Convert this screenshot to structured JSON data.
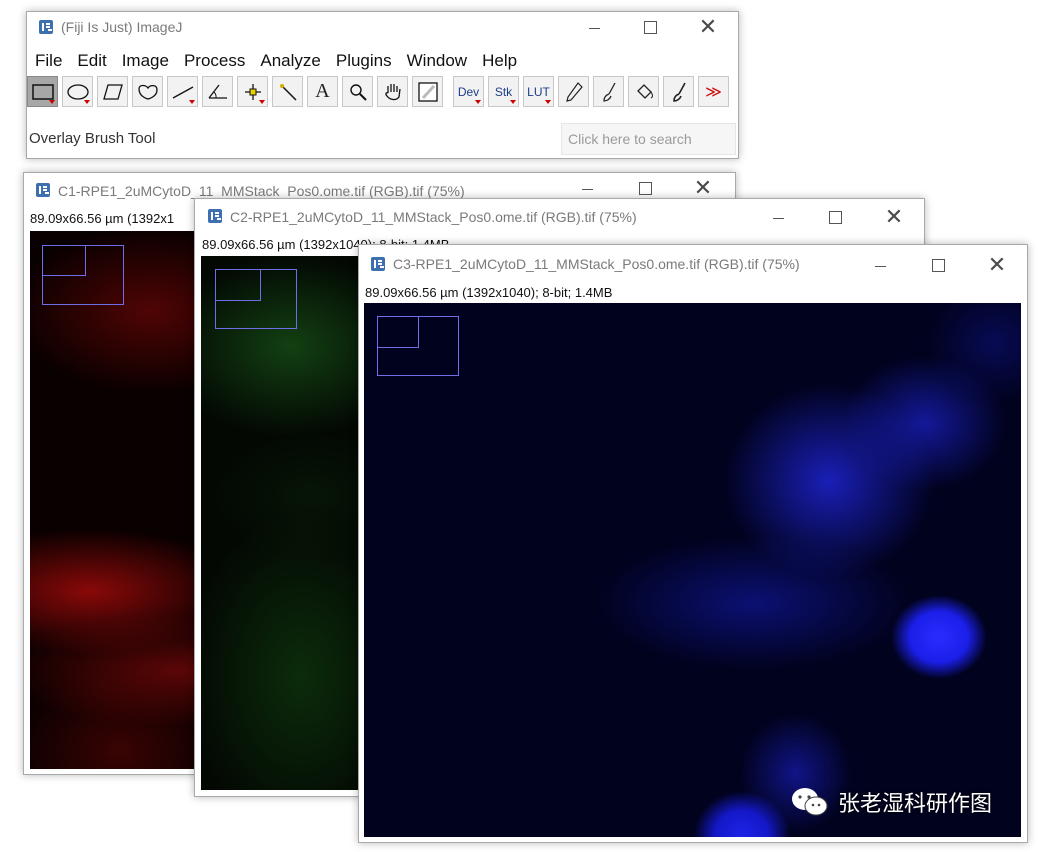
{
  "main_window": {
    "title": "(Fiji Is Just) ImageJ",
    "menu": [
      "File",
      "Edit",
      "Image",
      "Process",
      "Analyze",
      "Plugins",
      "Window",
      "Help"
    ],
    "tools": [
      {
        "name": "rectangle-tool",
        "glyph": "▭"
      },
      {
        "name": "oval-tool",
        "glyph": "◯"
      },
      {
        "name": "polygon-tool",
        "glyph": "⬠"
      },
      {
        "name": "freehand-tool",
        "glyph": "♡"
      },
      {
        "name": "line-tool",
        "glyph": "╱"
      },
      {
        "name": "angle-tool",
        "glyph": "∠"
      },
      {
        "name": "point-tool",
        "glyph": "✛"
      },
      {
        "name": "wand-tool",
        "glyph": "⟋"
      },
      {
        "name": "text-tool",
        "glyph": "A"
      },
      {
        "name": "zoom-tool",
        "glyph": "🔍"
      },
      {
        "name": "hand-tool",
        "glyph": "✋"
      },
      {
        "name": "color-picker-tool",
        "glyph": "⟋"
      },
      {
        "name": "dev-tool",
        "label": "Dev"
      },
      {
        "name": "stk-tool",
        "label": "Stk"
      },
      {
        "name": "lut-tool",
        "label": "LUT"
      },
      {
        "name": "pencil-tool",
        "glyph": "✎"
      },
      {
        "name": "brush-tool",
        "glyph": "✐"
      },
      {
        "name": "flood-fill-tool",
        "glyph": "♨"
      },
      {
        "name": "overlay-brush-tool",
        "glyph": "✐"
      },
      {
        "name": "more-tools",
        "glyph": "≫"
      }
    ],
    "status": "Overlay Brush Tool",
    "search_placeholder": "Click here to search"
  },
  "image_windows": [
    {
      "id": "c1",
      "title": "C1-RPE1_2uMCytoD_11_MMStack_Pos0.ome.tif (RGB).tif (75%)",
      "info": "89.09x66.56 µm (1392x1",
      "channel_color": "#ff2a2a"
    },
    {
      "id": "c2",
      "title": "C2-RPE1_2uMCytoD_11_MMStack_Pos0.ome.tif (RGB).tif (75%)",
      "info": "89.09x66.56 µm (1392x1040); 8-bit; 1.4MB",
      "channel_color": "#22cc22"
    },
    {
      "id": "c3",
      "title": "C3-RPE1_2uMCytoD_11_MMStack_Pos0.ome.tif (RGB).tif (75%)",
      "info": "89.09x66.56 µm (1392x1040); 8-bit; 1.4MB",
      "channel_color": "#1a2bff"
    }
  ],
  "watermark": "张老湿科研作图"
}
